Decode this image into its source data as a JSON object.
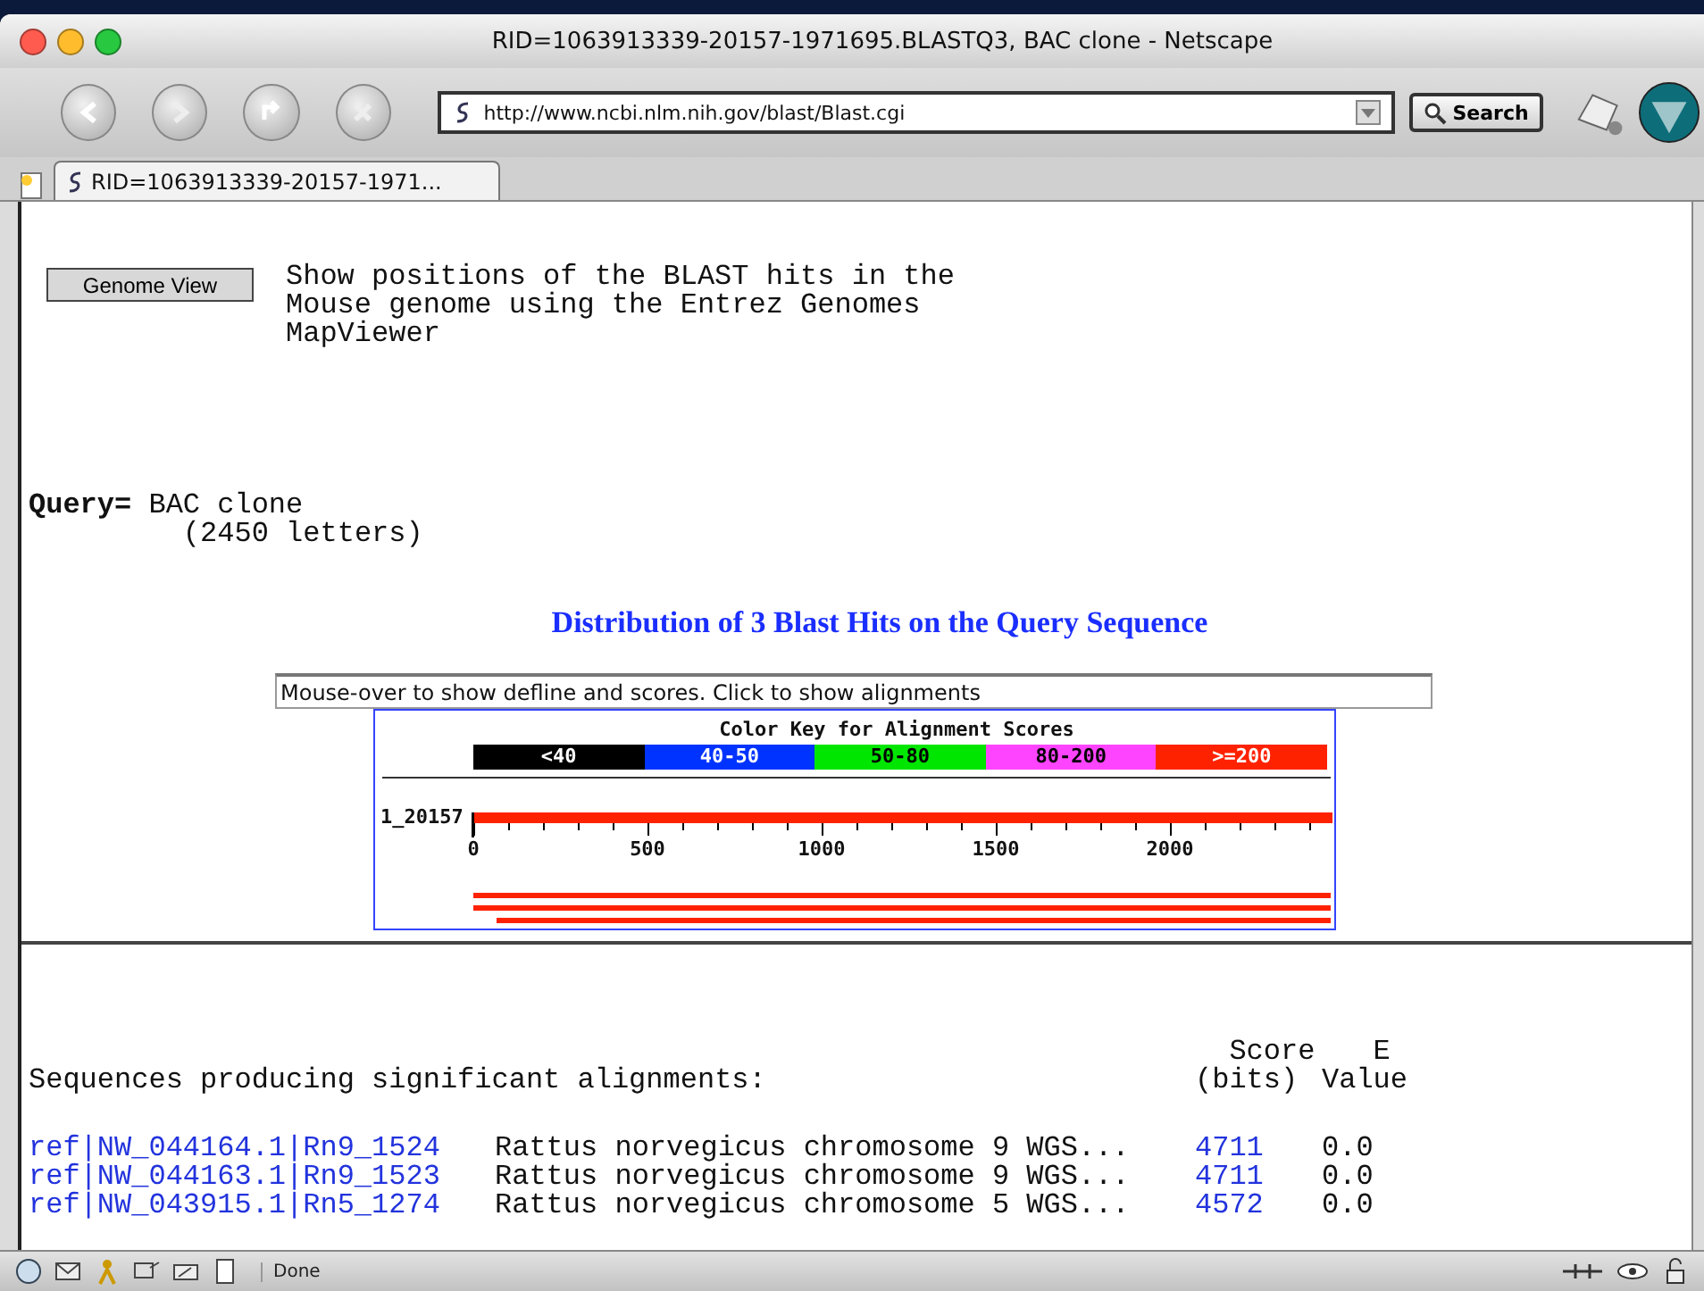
{
  "window": {
    "title": "RID=1063913339-20157-1971695.BLASTQ3, BAC clone - Netscape"
  },
  "toolbar": {
    "address": "http://www.ncbi.nlm.nih.gov/blast/Blast.cgi",
    "search_button": "Search"
  },
  "tabs": [
    {
      "label": "RID=1063913339-20157-1971...",
      "selected": true
    }
  ],
  "genome_view": {
    "button": "Genome View",
    "description": [
      "Show positions of the BLAST hits in the",
      "Mouse genome using the Entrez Genomes",
      "MapViewer"
    ]
  },
  "query": {
    "label": "Query=",
    "name": "BAC clone",
    "length": "(2450 letters)"
  },
  "distribution": {
    "title": "Distribution of 3 Blast Hits on the Query Sequence",
    "hint": {
      "value": "Mouse-over to show defline and scores. Click to show alignments"
    },
    "key_title": "Color Key for Alignment Scores",
    "key": [
      {
        "label": "<40",
        "color": "#000000"
      },
      {
        "label": "40-50",
        "color": "#0033ff"
      },
      {
        "label": "50-80",
        "color": "#00e600"
      },
      {
        "label": "80-200",
        "color": "#ff44ff"
      },
      {
        "label": ">=200",
        "color": "#ff2200"
      }
    ],
    "query_label": "1_20157",
    "ticks": [
      "0",
      "500",
      "1000",
      "1500",
      "2000"
    ]
  },
  "results": {
    "heading": "Sequences producing significant alignments:",
    "score_header": [
      "Score",
      "(bits)"
    ],
    "evalue_header": [
      "E",
      "Value"
    ],
    "rows": [
      {
        "id": "ref|NW_044164.1|Rn9_1524",
        "description": "Rattus norvegicus chromosome 9 WGS...",
        "score": "4711",
        "evalue": "0.0"
      },
      {
        "id": "ref|NW_044163.1|Rn9_1523",
        "description": "Rattus norvegicus chromosome 9 WGS...",
        "score": "4711",
        "evalue": "0.0"
      },
      {
        "id": "ref|NW_043915.1|Rn5_1274",
        "description": "Rattus norvegicus chromosome 5 WGS...",
        "score": "4572",
        "evalue": "0.0"
      }
    ]
  },
  "status_bar": {
    "text": "Done"
  }
}
